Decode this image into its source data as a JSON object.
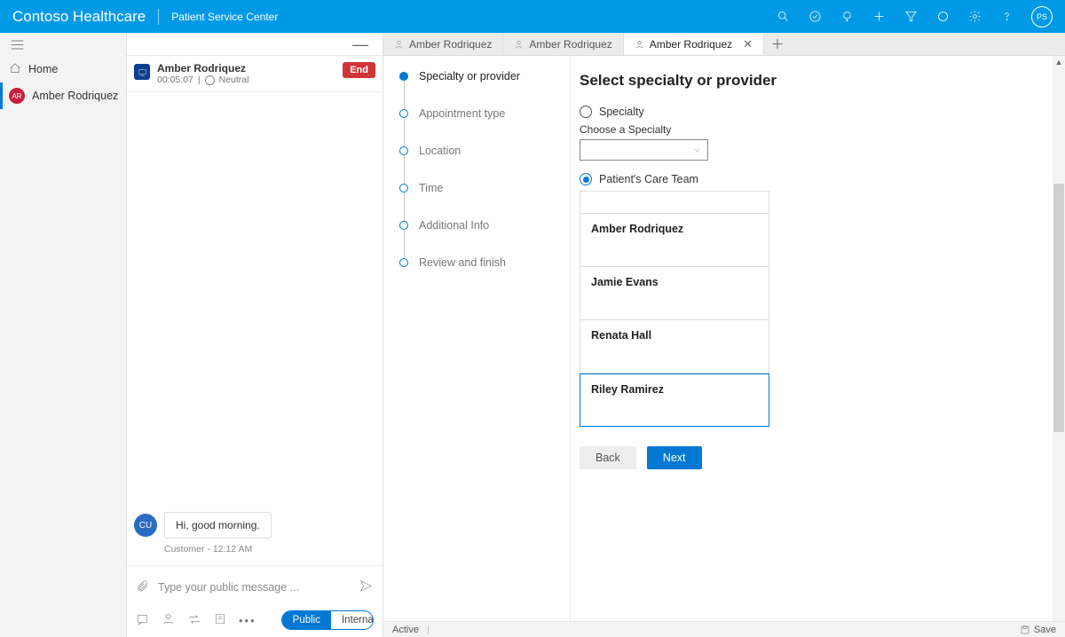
{
  "header": {
    "brand": "Contoso Healthcare",
    "workspace": "Patient Service Center",
    "avatar_initials": "PS"
  },
  "left_rail": {
    "home_label": "Home",
    "session_label": "Amber Rodriquez",
    "session_initials": "AR"
  },
  "conversation": {
    "person_name": "Amber Rodriquez",
    "timer": "00:05:07",
    "sentiment": "Neutral",
    "end_label": "End",
    "message_text": "Hi, good morning.",
    "message_sender_initials": "CU",
    "message_meta": "Customer - 12:12 AM",
    "compose_placeholder": "Type your public message ...",
    "pill_public": "Public",
    "pill_internal": "Internal"
  },
  "tabs": {
    "items": [
      "Amber Rodriquez",
      "Amber Rodriquez",
      "Amber Rodriquez"
    ],
    "active_index": 2
  },
  "stepper": {
    "steps": [
      "Specialty or provider",
      "Appointment type",
      "Location",
      "Time",
      "Additional Info",
      "Review and finish"
    ],
    "active_index": 0
  },
  "form": {
    "title": "Select specialty or provider",
    "option_specialty_label": "Specialty",
    "choose_specialty_label": "Choose a Specialty",
    "option_careteam_label": "Patient's Care Team",
    "selected_option": "careteam",
    "providers": [
      "Amber Rodriquez",
      "Jamie Evans",
      "Renata Hall",
      "Riley Ramirez"
    ],
    "selected_provider_index": 3,
    "back_label": "Back",
    "next_label": "Next"
  },
  "statusbar": {
    "state": "Active",
    "save_label": "Save"
  }
}
